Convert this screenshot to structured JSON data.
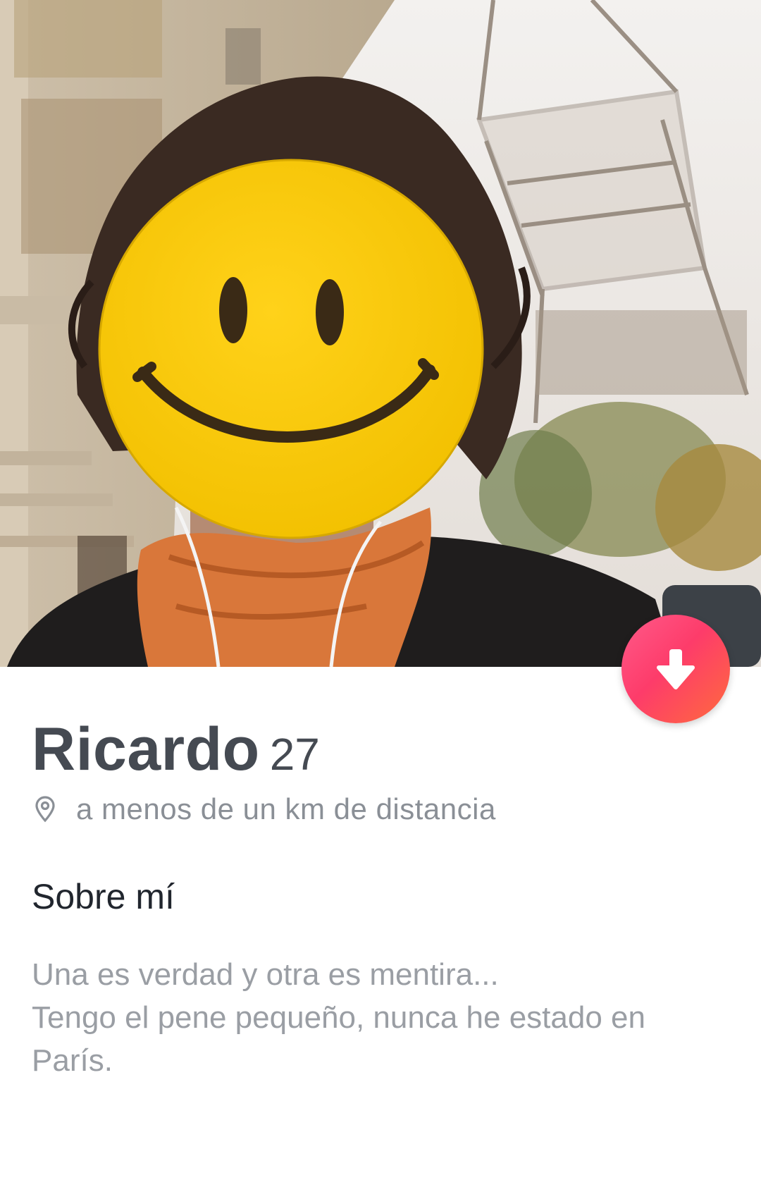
{
  "profile": {
    "name": "Ricardo",
    "age": "27",
    "distance": "a menos de un km de distancia",
    "photo_description_icon": "profile-photo",
    "expand_icon": "arrow-down-icon",
    "location_icon": "location-pin-icon"
  },
  "about": {
    "title": "Sobre mí",
    "lines": [
      "Una es verdad y otra es mentira...",
      "Tengo el pene pequeño, nunca he estado en",
      "París."
    ]
  },
  "colors": {
    "accent_gradient_start": "#ff5a8a",
    "accent_gradient_end": "#ff6b3d",
    "name_text": "#454a52",
    "secondary_text": "#8a8f96",
    "heading_text": "#21262e"
  }
}
